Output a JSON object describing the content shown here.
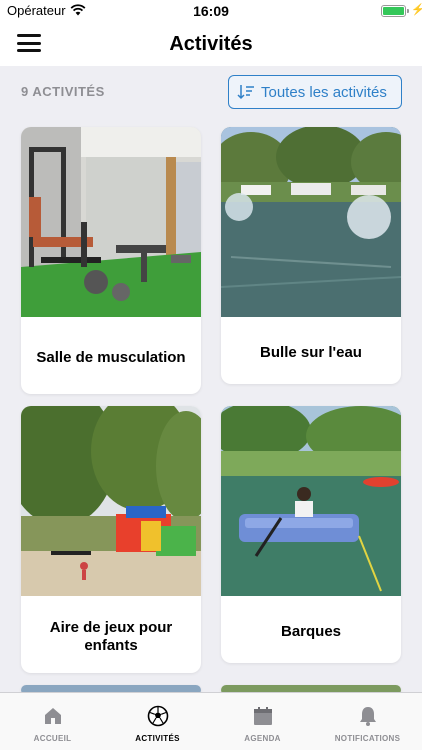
{
  "status_bar": {
    "carrier": "Opérateur",
    "time": "16:09",
    "battery_level": 1.0
  },
  "nav": {
    "title": "Activités",
    "menu_icon": "hamburger-menu-icon"
  },
  "list": {
    "count_label": "9 ACTIVITÉS",
    "filter_label": "Toutes les activités",
    "filter_icon": "sort-filter-icon"
  },
  "activities": [
    {
      "title": "Salle de musculation",
      "photo": "gym-photo"
    },
    {
      "title": "Bulle sur l'eau",
      "photo": "water-bubble-photo"
    },
    {
      "title": "Aire de jeux pour enfants",
      "photo": "playground-photo"
    },
    {
      "title": "Barques",
      "photo": "rowboat-photo"
    }
  ],
  "tabs": [
    {
      "label": "ACCUEIL",
      "icon": "home-icon",
      "active": false
    },
    {
      "label": "ACTIVITÉS",
      "icon": "soccer-ball-icon",
      "active": true
    },
    {
      "label": "AGENDA",
      "icon": "calendar-icon",
      "active": false
    },
    {
      "label": "NOTIFICATIONS",
      "icon": "bell-icon",
      "active": false
    }
  ],
  "colors": {
    "accent": "#2f80c8",
    "background": "#eeeef3",
    "battery": "#34c759"
  }
}
